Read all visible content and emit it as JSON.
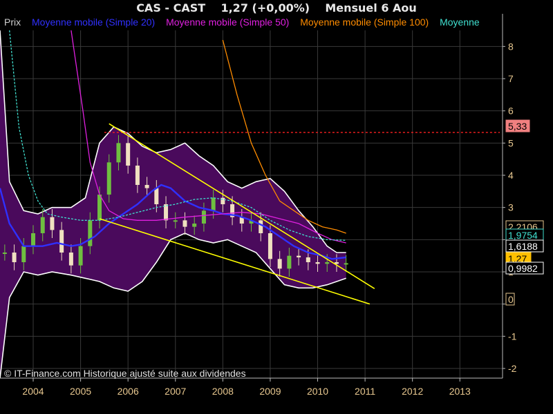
{
  "header": {
    "symbol": "CAS - CAST",
    "quote": "1,27 (+0,00%)",
    "period": "Mensuel  6 Aou"
  },
  "legend": [
    {
      "label": "Prix",
      "color": "#d0d0d0"
    },
    {
      "label": "Moyenne mobile (Simple 20)",
      "color": "#3030ff"
    },
    {
      "label": "Moyenne mobile (Simple 50)",
      "color": "#e020e0"
    },
    {
      "label": "Moyenne mobile (Simple 100)",
      "color": "#ff8c00"
    },
    {
      "label": "Moyenne",
      "color": "#40e0d0"
    }
  ],
  "footer": "© IT-Finance.com Historique ajusté suite aux dividendes",
  "colors": {
    "background": "#000000",
    "bollinger_fill": "#4a0a5c",
    "grid": "#3a3a3a",
    "axis_text": "#e8c890",
    "candle_up": "#6fbf40",
    "candle_down": "#f0e0c0",
    "trendline": "#ffff00",
    "resistance": "#ff2020"
  },
  "chart_data": {
    "type": "line",
    "x_axis": {
      "ticks": [
        "2004",
        "2005",
        "2006",
        "2007",
        "2008",
        "2009",
        "2010",
        "2011",
        "2012",
        "2013"
      ],
      "range": [
        2003.3,
        2013.9
      ]
    },
    "y_axis": {
      "ticks": [
        -2,
        -1,
        0,
        1,
        2,
        3,
        4,
        5,
        6,
        7,
        8
      ],
      "range": [
        -2.3,
        8.5
      ],
      "side": "right"
    },
    "grid": true,
    "price_labels": [
      "5,33",
      "2,2106",
      "1,9754",
      "1,6188",
      "1,27",
      "0,9982",
      "0"
    ],
    "resistance_level": 5.33,
    "price_close": {
      "x": [
        2003.4,
        2003.6,
        2003.8,
        2004.0,
        2004.2,
        2004.4,
        2004.6,
        2004.8,
        2005.0,
        2005.2,
        2005.4,
        2005.6,
        2005.8,
        2006.0,
        2006.2,
        2006.4,
        2006.6,
        2006.8,
        2007.0,
        2007.2,
        2007.4,
        2007.6,
        2007.8,
        2008.0,
        2008.2,
        2008.4,
        2008.6,
        2008.8,
        2009.0,
        2009.2,
        2009.4,
        2009.6,
        2009.8,
        2010.0,
        2010.2,
        2010.4,
        2010.6
      ],
      "y": [
        1.6,
        1.3,
        1.8,
        2.2,
        2.7,
        2.3,
        1.6,
        1.2,
        1.8,
        2.6,
        3.4,
        4.4,
        5.0,
        4.3,
        3.7,
        3.6,
        3.1,
        2.6,
        2.6,
        2.4,
        2.5,
        2.9,
        3.3,
        3.1,
        2.7,
        2.5,
        2.6,
        2.2,
        1.4,
        1.1,
        1.5,
        1.45,
        1.3,
        1.25,
        1.3,
        1.25,
        1.27
      ]
    },
    "series": [
      {
        "name": "Moyenne mobile (Simple 20)",
        "color": "#3030ff",
        "x": [
          2003.3,
          2003.5,
          2003.8,
          2004.2,
          2004.5,
          2004.8,
          2005.0,
          2005.3,
          2005.6,
          2005.9,
          2006.2,
          2006.5,
          2006.7,
          2006.9,
          2007.2,
          2007.5,
          2007.8,
          2008.0,
          2008.3,
          2008.6,
          2008.9,
          2009.2,
          2009.5,
          2009.8,
          2010.1,
          2010.3,
          2010.6
        ],
        "y": [
          3.6,
          2.5,
          1.8,
          1.8,
          1.9,
          1.8,
          1.85,
          2.1,
          2.5,
          2.8,
          3.1,
          3.5,
          3.7,
          3.6,
          3.2,
          3.0,
          2.9,
          2.8,
          2.75,
          2.6,
          2.4,
          2.1,
          1.8,
          1.6,
          1.5,
          1.4,
          1.45
        ]
      },
      {
        "name": "Moyenne mobile (Simple 50)",
        "color": "#e020e0",
        "x": [
          2004.8,
          2004.9,
          2005.05,
          2005.2,
          2005.4,
          2005.6,
          2005.9,
          2006.2,
          2006.6,
          2006.9,
          2007.2,
          2007.6,
          2008.0,
          2008.4,
          2008.8,
          2009.2,
          2009.6,
          2010.0,
          2010.3,
          2010.6
        ],
        "y": [
          8.5,
          7.5,
          6.0,
          4.4,
          3.4,
          2.9,
          2.65,
          2.6,
          2.6,
          2.65,
          2.7,
          2.75,
          2.8,
          2.85,
          2.8,
          2.65,
          2.5,
          2.2,
          2.0,
          1.9
        ]
      },
      {
        "name": "Moyenne mobile (Simple 100)",
        "color": "#ff8c00",
        "x": [
          2008.0,
          2008.3,
          2008.6,
          2008.9,
          2009.2,
          2009.5,
          2009.8,
          2010.1,
          2010.4,
          2010.6
        ],
        "y": [
          8.2,
          6.5,
          5.0,
          4.0,
          3.2,
          2.9,
          2.6,
          2.4,
          2.3,
          2.2
        ]
      },
      {
        "name": "Moyenne",
        "color": "#40e0d0",
        "x": [
          2003.5,
          2003.7,
          2003.9,
          2004.1,
          2004.3,
          2004.6,
          2005.0,
          2005.4,
          2005.8,
          2006.2,
          2006.6,
          2007.0,
          2007.4,
          2007.8,
          2008.2,
          2008.6,
          2009.0,
          2009.4,
          2009.8,
          2010.2,
          2010.6
        ],
        "y": [
          8.5,
          5.5,
          4.0,
          3.2,
          2.8,
          2.7,
          2.6,
          2.6,
          2.7,
          2.85,
          3.0,
          3.1,
          3.25,
          3.3,
          3.2,
          3.0,
          2.6,
          2.3,
          2.1,
          2.0,
          1.98
        ]
      }
    ],
    "bollinger_band": {
      "x": [
        2003.3,
        2003.5,
        2003.8,
        2004.1,
        2004.4,
        2004.8,
        2005.1,
        2005.4,
        2005.7,
        2006.0,
        2006.3,
        2006.6,
        2006.9,
        2007.2,
        2007.5,
        2007.8,
        2008.1,
        2008.4,
        2008.7,
        2009.0,
        2009.3,
        2009.6,
        2009.9,
        2010.2,
        2010.4,
        2010.6
      ],
      "upper": [
        8.5,
        3.8,
        2.9,
        2.8,
        3.0,
        3.0,
        3.3,
        5.0,
        5.5,
        5.3,
        4.9,
        4.7,
        4.8,
        5.0,
        4.6,
        4.3,
        3.8,
        3.6,
        3.8,
        3.9,
        3.5,
        2.9,
        2.4,
        1.8,
        1.6,
        1.6
      ],
      "lower": [
        -2.3,
        0.2,
        1.0,
        0.9,
        1.0,
        0.9,
        0.8,
        0.7,
        0.5,
        0.4,
        0.7,
        1.3,
        2.0,
        2.2,
        2.0,
        1.9,
        2.0,
        1.8,
        1.6,
        1.1,
        0.6,
        0.5,
        0.5,
        0.6,
        0.7,
        0.8
      ]
    },
    "trendlines": [
      {
        "x": [
          2005.6,
          2011.2
        ],
        "y": [
          5.6,
          0.48
        ]
      },
      {
        "x": [
          2005.4,
          2011.1
        ],
        "y": [
          2.65,
          0.0
        ]
      }
    ]
  }
}
